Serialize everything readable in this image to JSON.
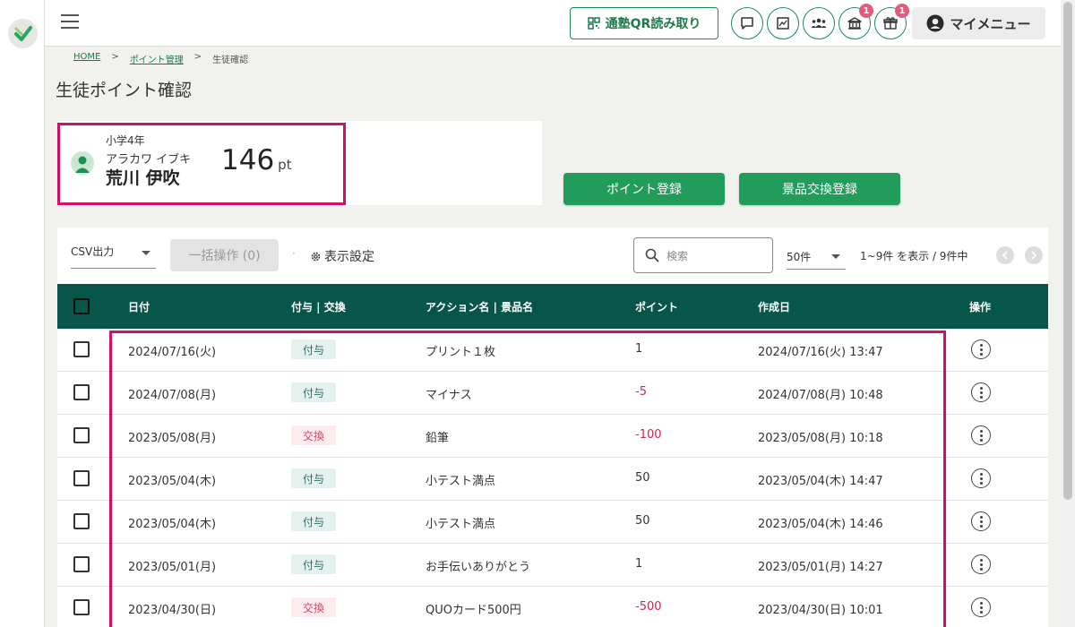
{
  "header": {
    "qr_button": "通塾QR読み取り",
    "my_menu": "マイメニュー",
    "badge_school": "1",
    "badge_gift": "1"
  },
  "breadcrumb": {
    "home": "HOME",
    "sep": ">",
    "points": "ポイント管理",
    "current": "生徒確認"
  },
  "page_title": "生徒ポイント確認",
  "student": {
    "grade": "小学4年",
    "kana": "アラカワ イブキ",
    "name": "荒川 伊吹",
    "points": "146",
    "unit": "pt"
  },
  "actions": {
    "register_points": "ポイント登録",
    "register_exchange": "景品交換登録"
  },
  "toolbar": {
    "csv": "CSV出力",
    "bulk": "一括操作 (0)",
    "dot": "·",
    "display_settings": "表示設定",
    "search_placeholder": "検索",
    "per_page": "50件",
    "range": "1~9件 を表示 / 9件中"
  },
  "table": {
    "headers": {
      "date": "日付",
      "type": "付与 | 交換",
      "action": "アクション名 | 景品名",
      "points": "ポイント",
      "created": "作成日",
      "ops": "操作"
    },
    "rows": [
      {
        "date": "2024/07/16(火)",
        "type": "付与",
        "kind": "grant",
        "action": "プリント１枚",
        "points": "1",
        "created": "2024/07/16(火) 13:47"
      },
      {
        "date": "2024/07/08(月)",
        "type": "付与",
        "kind": "grant",
        "action": "マイナス",
        "points": "-5",
        "created": "2024/07/08(月) 10:48"
      },
      {
        "date": "2023/05/08(月)",
        "type": "交換",
        "kind": "exchange",
        "action": "鉛筆",
        "points": "-100",
        "created": "2023/05/08(月) 10:18"
      },
      {
        "date": "2023/05/04(木)",
        "type": "付与",
        "kind": "grant",
        "action": "小テスト満点",
        "points": "50",
        "created": "2023/05/04(木) 14:47"
      },
      {
        "date": "2023/05/04(木)",
        "type": "付与",
        "kind": "grant",
        "action": "小テスト満点",
        "points": "50",
        "created": "2023/05/04(木) 14:46"
      },
      {
        "date": "2023/05/01(月)",
        "type": "付与",
        "kind": "grant",
        "action": "お手伝いありがとう",
        "points": "1",
        "created": "2023/05/01(月) 14:27"
      },
      {
        "date": "2023/04/30(日)",
        "type": "交換",
        "kind": "exchange",
        "action": "QUOカード500円",
        "points": "-500",
        "created": "2023/04/30(日) 10:01"
      }
    ]
  },
  "colors": {
    "brand_green": "#219c5a",
    "table_header": "#075649",
    "highlight": "#d10f68",
    "negative": "#d4244a"
  }
}
